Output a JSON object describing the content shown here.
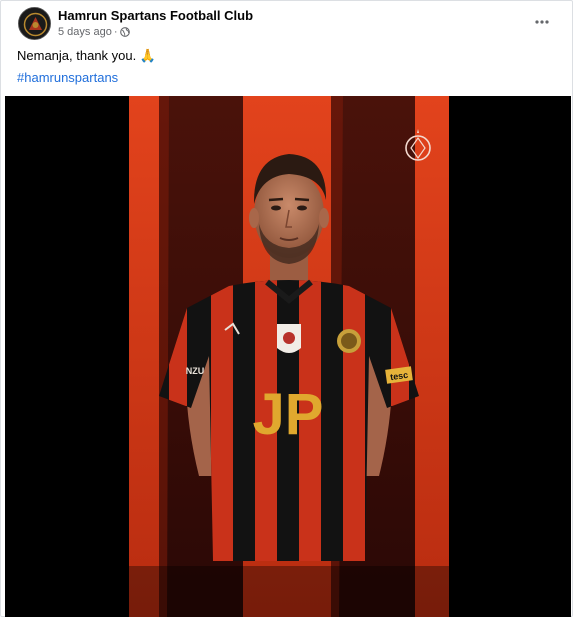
{
  "post": {
    "page_name": "Hamrun Spartans Football Club",
    "time": "5 days ago",
    "dot": "·",
    "text": "Nemanja, thank you. 🙏",
    "hashtag": "#hamrunspartans"
  },
  "media": {
    "sponsor_text": "JP",
    "sleeve_left_text": "NZU",
    "sleeve_right_text": "tesc"
  },
  "icons": {
    "globe": "globe-icon",
    "more": "more-options-icon",
    "crest": "club-crest-icon"
  },
  "colors": {
    "hashtag": "#216fdb",
    "stripe_red": "#d63a18",
    "jersey_black": "#111111",
    "sponsor_gold": "#e0a82e"
  }
}
